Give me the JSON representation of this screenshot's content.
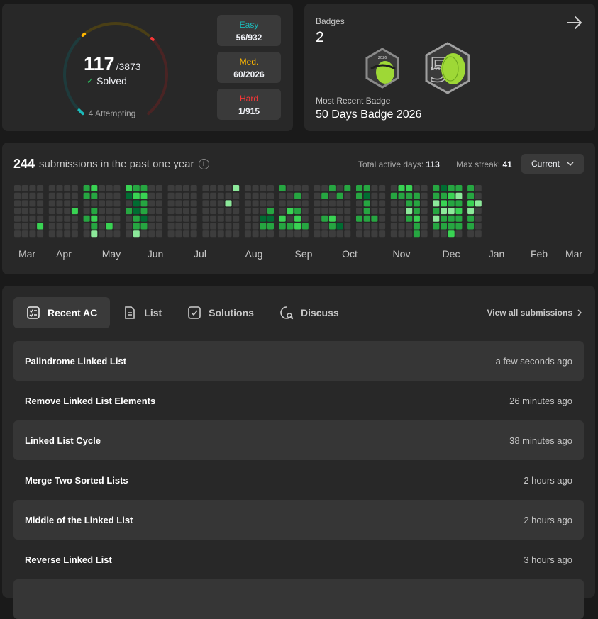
{
  "solved": {
    "count": "117",
    "total": "/3873",
    "label": "Solved",
    "attempting": "4 Attempting",
    "difficulties": [
      {
        "label": "Easy",
        "value": "56/932",
        "color": "#1cbaba",
        "solved": 56,
        "total": 932
      },
      {
        "label": "Med.",
        "value": "60/2026",
        "color": "#ffb700",
        "solved": 60,
        "total": 2026
      },
      {
        "label": "Hard",
        "value": "1/915",
        "color": "#f63737",
        "solved": 1,
        "total": 915
      }
    ]
  },
  "badges": {
    "title": "Badges",
    "count": "2",
    "recent_label": "Most Recent Badge",
    "recent_name": "50 Days Badge 2026",
    "badge1_text": "2026",
    "badge2_text": "DAYS"
  },
  "calendar": {
    "count": "244",
    "label": "submissions in the past one year",
    "active_days_label": "Total active days:",
    "active_days": "113",
    "max_streak_label": "Max streak:",
    "max_streak": "41",
    "select_label": "Current",
    "months": [
      "Mar",
      "Apr",
      "May",
      "Jun",
      "Jul",
      "Aug",
      "Sep",
      "Oct",
      "Nov",
      "Dec",
      "Jan",
      "Feb",
      "Mar"
    ],
    "level_colors": [
      "#3d3d3d",
      "#0e4429",
      "#006d32",
      "#26a641",
      "#39d353",
      "#8ce99a"
    ]
  },
  "recent": {
    "tabs": [
      {
        "label": "Recent AC",
        "icon": "checklist-icon"
      },
      {
        "label": "List",
        "icon": "document-icon"
      },
      {
        "label": "Solutions",
        "icon": "checkbox-icon"
      },
      {
        "label": "Discuss",
        "icon": "discuss-icon"
      }
    ],
    "view_all": "View all submissions",
    "items": [
      {
        "title": "Palindrome Linked List",
        "time": "a few seconds ago"
      },
      {
        "title": "Remove Linked List Elements",
        "time": "26 minutes ago"
      },
      {
        "title": "Linked List Cycle",
        "time": "38 minutes ago"
      },
      {
        "title": "Merge Two Sorted Lists",
        "time": "2 hours ago"
      },
      {
        "title": "Middle of the Linked List",
        "time": "2 hours ago"
      },
      {
        "title": "Reverse Linked List",
        "time": "3 hours ago"
      }
    ]
  }
}
